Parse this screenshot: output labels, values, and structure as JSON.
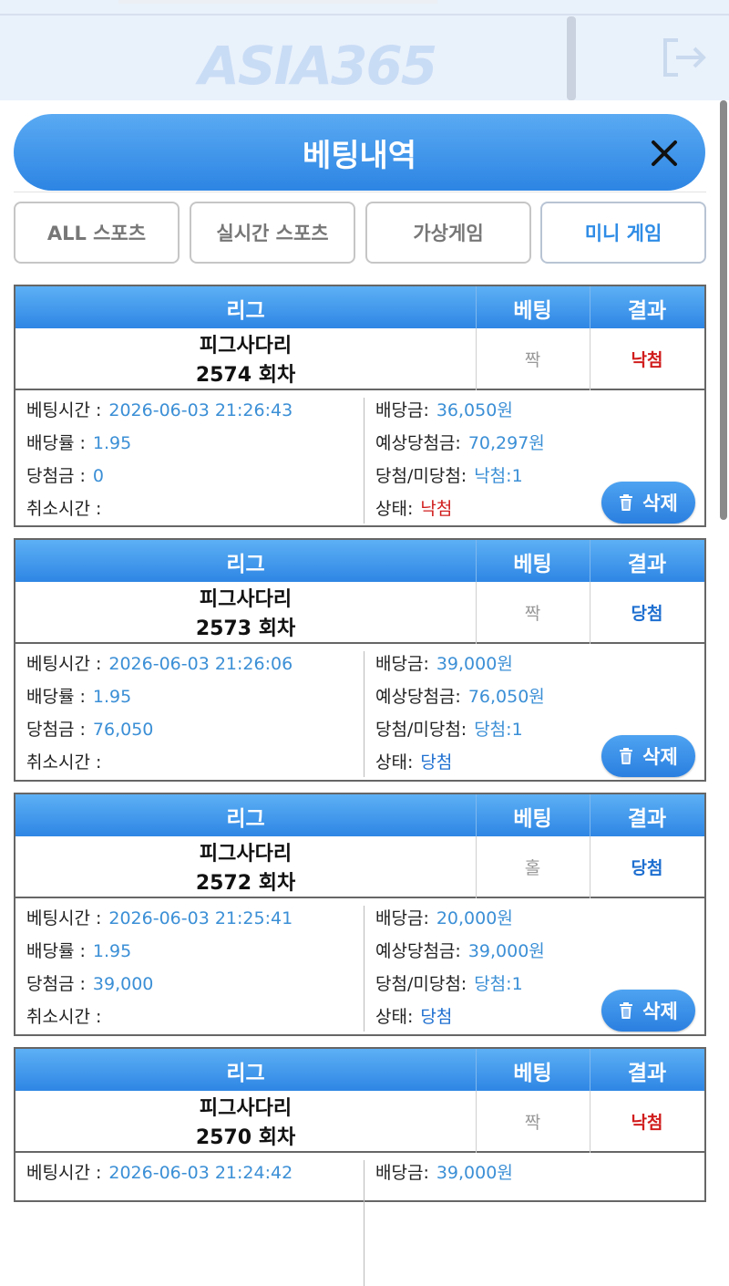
{
  "header": {
    "logo_text": "ASIA365",
    "title": "베팅내역"
  },
  "tabs": [
    {
      "label": "ALL 스포츠"
    },
    {
      "label": "실시간 스포츠"
    },
    {
      "label": "가상게임"
    },
    {
      "label": "미니 게임",
      "active": true
    }
  ],
  "columns": {
    "league": "리그",
    "bet": "베팅",
    "result": "결과"
  },
  "labels": {
    "bet_time": "베팅시간 :",
    "odds": "배당률 :",
    "win_amount": "당첨금 :",
    "cancel_time": "취소시간 :",
    "stake": "배당금:",
    "expected_win": "예상당첨금:",
    "win_lose": "당첨/미당첨:",
    "status": "상태:",
    "delete": "삭제"
  },
  "bets": [
    {
      "game": "피그사다리",
      "round": "2574 회차",
      "pick": "짝",
      "result": "낙첨",
      "outcome": "lose",
      "bet_time": "2026-06-03 21:26:43",
      "odds": "1.95",
      "win_amount": "0",
      "cancel_time": "",
      "stake": "36,050원",
      "expected_win": "70,297원",
      "win_lose": "낙첨:1",
      "status": "낙첨"
    },
    {
      "game": "피그사다리",
      "round": "2573 회차",
      "pick": "짝",
      "result": "당첨",
      "outcome": "win",
      "bet_time": "2026-06-03 21:26:06",
      "odds": "1.95",
      "win_amount": "76,050",
      "cancel_time": "",
      "stake": "39,000원",
      "expected_win": "76,050원",
      "win_lose": "당첨:1",
      "status": "당첨"
    },
    {
      "game": "피그사다리",
      "round": "2572 회차",
      "pick": "홀",
      "result": "당첨",
      "outcome": "win",
      "bet_time": "2026-06-03 21:25:41",
      "odds": "1.95",
      "win_amount": "39,000",
      "cancel_time": "",
      "stake": "20,000원",
      "expected_win": "39,000원",
      "win_lose": "당첨:1",
      "status": "당첨"
    },
    {
      "game": "피그사다리",
      "round": "2570 회차",
      "pick": "짝",
      "result": "낙첨",
      "outcome": "lose",
      "bet_time": "2026-06-03 21:24:42",
      "stake": "39,000원"
    }
  ],
  "colors": {
    "accent": "#2e8ce6",
    "lose": "#d11c1c",
    "win": "#1e6fd0"
  }
}
